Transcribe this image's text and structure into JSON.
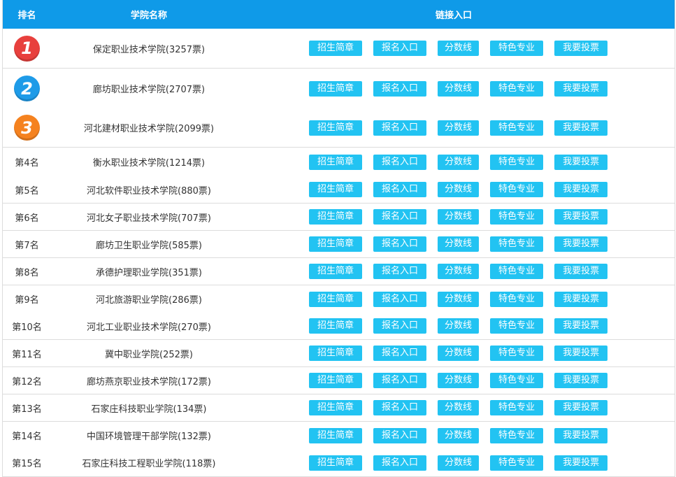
{
  "header": {
    "rank": "排名",
    "name": "学院名称",
    "links": "链接入口"
  },
  "buttons": [
    "招生简章",
    "报名入口",
    "分数线",
    "特色专业",
    "我要投票"
  ],
  "colors": {
    "header_bg": "#0f9ae8",
    "button_bg": "#22c3f2",
    "badge1": "#e8403d",
    "badge2": "#1e9be8",
    "badge3": "#f5821f"
  },
  "rows": [
    {
      "rank": "1",
      "name": "保定职业技术学院(3257票)"
    },
    {
      "rank": "2",
      "name": "廊坊职业技术学院(2707票)"
    },
    {
      "rank": "3",
      "name": "河北建材职业技术学院(2099票)"
    },
    {
      "rank": "第4名",
      "name": "衡水职业技术学院(1214票)"
    },
    {
      "rank": "第5名",
      "name": "河北软件职业技术学院(880票)"
    },
    {
      "rank": "第6名",
      "name": "河北女子职业技术学院(707票)"
    },
    {
      "rank": "第7名",
      "name": "廊坊卫生职业学院(585票)"
    },
    {
      "rank": "第8名",
      "name": "承德护理职业学院(351票)"
    },
    {
      "rank": "第9名",
      "name": "河北旅游职业学院(286票)"
    },
    {
      "rank": "第10名",
      "name": "河北工业职业技术学院(270票)"
    },
    {
      "rank": "第11名",
      "name": "冀中职业学院(252票)"
    },
    {
      "rank": "第12名",
      "name": "廊坊燕京职业技术学院(172票)"
    },
    {
      "rank": "第13名",
      "name": "石家庄科技职业学院(134票)"
    },
    {
      "rank": "第14名",
      "name": "中国环境管理干部学院(132票)"
    },
    {
      "rank": "第15名",
      "name": "石家庄科技工程职业学院(118票)"
    }
  ]
}
